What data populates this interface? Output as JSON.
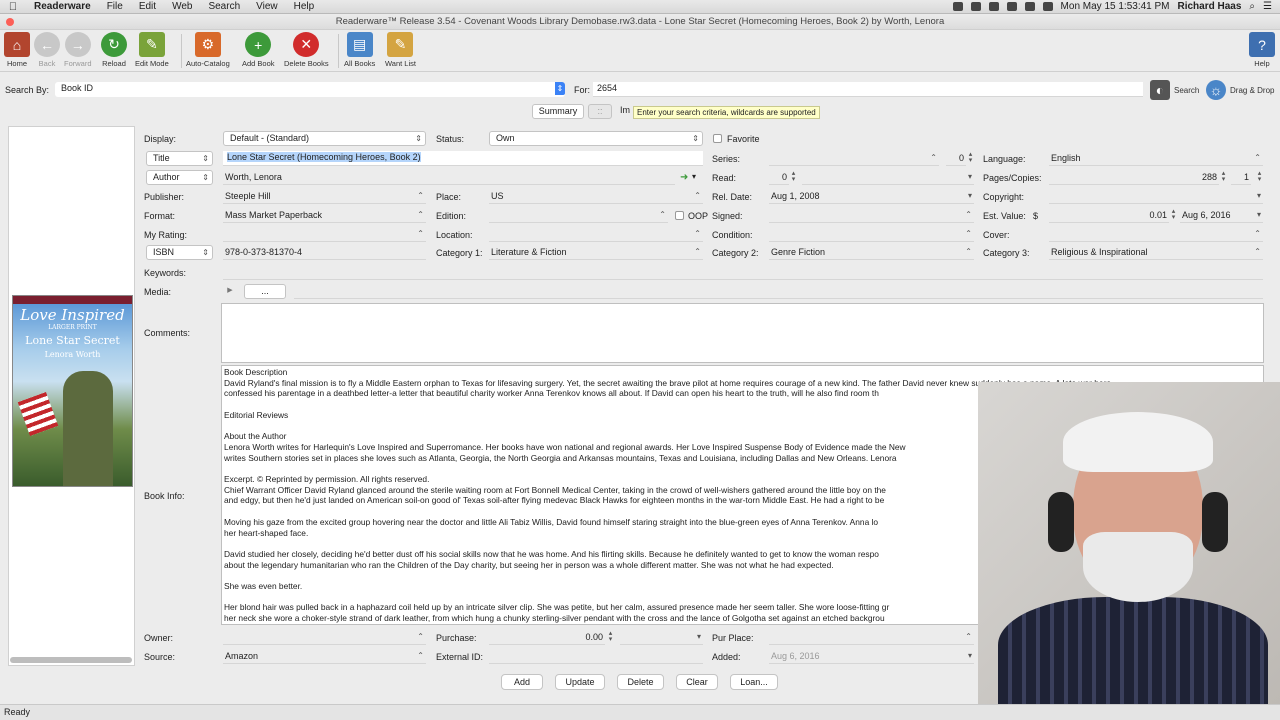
{
  "menubar": {
    "app": "Readerware",
    "items": [
      "File",
      "Edit",
      "Web",
      "Search",
      "View",
      "Help"
    ],
    "clock": "Mon May 15  1:53:41 PM",
    "user": "Richard Haas"
  },
  "window": {
    "title": "Readerware™ Release 3.54 - Covenant Woods Library Demobase.rw3.data - Lone Star Secret (Homecoming Heroes, Book 2) by Worth, Lenora"
  },
  "toolbar": {
    "home": "Home",
    "back": "Back",
    "forward": "Forward",
    "reload": "Reload",
    "edit_mode": "Edit Mode",
    "auto_catalog": "Auto-Catalog",
    "add_book": "Add Book",
    "delete_books": "Delete Books",
    "all_books": "All Books",
    "want_list": "Want List",
    "help": "Help"
  },
  "search": {
    "by_label": "Search By:",
    "by_value": "Book ID",
    "for_label": "For:",
    "for_value": "2654",
    "search_button": "Search",
    "drag_drop": "Drag & Drop",
    "tooltip": "Enter your search criteria, wildcards are supported"
  },
  "tabs": {
    "summary": "Summary",
    "tab2": "Im"
  },
  "form": {
    "display_label": "Display:",
    "display_value": "Default - (Standard)",
    "status_label": "Status:",
    "status_value": "Own",
    "favorite_label": "Favorite",
    "title_field": "Title",
    "title_value": "Lone Star Secret (Homecoming Heroes, Book 2)",
    "series_label": "Series:",
    "series_value": "",
    "series_num": "0",
    "language_label": "Language:",
    "language_value": "English",
    "author_field": "Author",
    "author_value": "Worth, Lenora",
    "read_label": "Read:",
    "read_num": "0",
    "pages_label": "Pages/Copies:",
    "pages_value": "288",
    "copies_value": "1",
    "publisher_label": "Publisher:",
    "publisher_value": "Steeple Hill",
    "place_label": "Place:",
    "place_value": "US",
    "reldate_label": "Rel. Date:",
    "reldate_value": "Aug 1, 2008",
    "copyright_label": "Copyright:",
    "format_label": "Format:",
    "format_value": "Mass Market Paperback",
    "edition_label": "Edition:",
    "oop_label": "OOP",
    "signed_label": "Signed:",
    "estvalue_label": "Est. Value:",
    "currency": "$",
    "estvalue": "0.01",
    "estvalue_date": "Aug 6, 2016",
    "rating_label": "My Rating:",
    "location_label": "Location:",
    "condition_label": "Condition:",
    "cover_label": "Cover:",
    "isbn_field": "ISBN",
    "isbn_value": "978-0-373-81370-4",
    "cat1_label": "Category 1:",
    "cat1_value": "Literature & Fiction",
    "cat2_label": "Category 2:",
    "cat2_value": "Genre Fiction",
    "cat3_label": "Category 3:",
    "cat3_value": "Religious & Inspirational",
    "keywords_label": "Keywords:",
    "media_label": "Media:",
    "media_button": "...",
    "comments_label": "Comments:",
    "bookinfo_label": "Book Info:",
    "owner_label": "Owner:",
    "purchase_label": "Purchase:",
    "purchase_value": "0.00",
    "purplace_label": "Pur Place:",
    "source_label": "Source:",
    "source_value": "Amazon",
    "extid_label": "External ID:",
    "added_label": "Added:",
    "added_value": "Aug 6, 2016"
  },
  "cover_image": {
    "brand": "Love Inspired",
    "line": "LARGER PRINT",
    "title": "Lone Star Secret",
    "author": "Lenora Worth",
    "series": "HOMECOMING HEROES",
    "top_band": "HEARTWARMING INSPIRATIONAL ROMANCE"
  },
  "bookinfo_text": "Book Description\nDavid Ryland's final mission is to fly a Middle Eastern orphan to Texas for lifesaving surgery. Yet, the secret awaiting the brave pilot at home requires courage of a new kind. The father David never knew suddenly has a name. A late war hero\nconfessed his parentage in a deathbed letter-a letter that beautiful charity worker Anna Terenkov knows all about. If David can open his heart to the truth, will he also find room th\n\nEditorial Reviews\n\nAbout the Author\nLenora Worth writes for Harlequin's Love Inspired and Superromance. Her books have won national and regional awards. Her Love Inspired Suspense Body of Evidence made the New\nwrites Southern stories set in places she loves such as Atlanta, Georgia, the North Georgia and Arkansas mountains, Texas and Louisiana, including Dallas and New Orleans. Lenora\n\nExcerpt. © Reprinted by permission. All rights reserved.\nChief Warrant Officer David Ryland glanced around the sterile waiting room at Fort Bonnell Medical Center, taking in the crowd of well-wishers gathered around the little boy on the\nand edgy, but then he'd just landed on American soil-on good ol' Texas soil-after flying medevac Black Hawks for eighteen months in the war-torn Middle East. He had a right to be\n\nMoving his gaze from the excited group hovering near the doctor and little Ali Tabiz Willis, David found himself staring straight into the blue-green eyes of Anna Terenkov. Anna lo\nher heart-shaped face.\n\nDavid studied her closely, deciding he'd better dust off his social skills now that he was home. And his flirting skills. Because he definitely wanted to get to know the woman respo\nabout the legendary humanitarian who ran the Children of the Day charity, but seeing her in person was a whole different matter. She was not what he had expected.\n\nShe was even better.\n\nHer blond hair was pulled back in a haphazard coil held up by an intricate silver clip. She was petite, but her calm, assured presence made her seem taller. She wore loose-fitting gr\nher neck she wore a choker-style strand of dark leather, from which hung a chunky sterling-silver pendant with the cross and the lance of Golgotha set against an etched backgrou",
  "buttons": {
    "add": "Add",
    "update": "Update",
    "delete": "Delete",
    "clear": "Clear",
    "loan": "Loan..."
  },
  "status_text": "Ready",
  "colors": {
    "accent": "#3b82f6",
    "selection": "#b5d5fb",
    "tooltip": "#ffffc8"
  }
}
